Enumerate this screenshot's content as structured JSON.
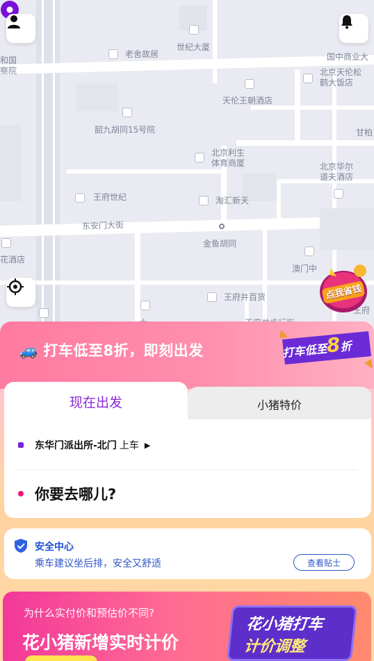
{
  "map": {
    "labels": {
      "he_guo": "和国",
      "cha_yuan": "察院",
      "lao_she": "老舍故居",
      "shiji_dasha": "世纪大厦",
      "guoji_shangye": "国中商业大",
      "tianlun_songhe_1": "北京天伦松",
      "tianlun_songhe_2": "鹤大饭店",
      "tianlun_wangchao": "天伦王朝酒店",
      "shaojiu": "韶九胡同15号院",
      "ganbai": "甘柏",
      "lisheng_1": "北京利生",
      "lisheng_2": "体育商厦",
      "huaer_1": "北京华尔",
      "huaer_2": "道夫酒店",
      "wangfu_shiji": "王府世纪",
      "danghui": "淘汇新天",
      "dongan": "东安门大街",
      "jinyu": "金鱼胡同",
      "hua_jiudian": "花酒店",
      "aomen": "澳门中",
      "wangfujing_baihuo": "王府井百货",
      "wangfu_right": "王府",
      "bottom_cut_1": "大",
      "bottom_cut_2": "王府井步行街"
    },
    "promo_badge": "点我省钱"
  },
  "header": {
    "user_icon": "user-icon",
    "bell_icon": "bell-icon",
    "locate_icon": "locate-icon"
  },
  "banner": {
    "emoji": "🚙",
    "title": "打车低至8折，即刻出发",
    "art_text": "打车低至",
    "art_big": "8",
    "art_suffix": "折"
  },
  "tabs": {
    "active": "现在出发",
    "inactive": "小猪特价"
  },
  "trip": {
    "pickup_name": "东华门派出所-北门",
    "pickup_suffix": "上车",
    "destination_placeholder": "你要去哪儿?"
  },
  "safety": {
    "title": "安全中心",
    "subtitle": "乘车建议坐后排，安全又舒适",
    "button": "查看贴士"
  },
  "bottom_promo": {
    "question": "为什么实付价和预估价不同?",
    "title": "花小猪新增实时计价",
    "art_line1": "花小猪打车",
    "art_line2": "计价调整"
  },
  "colors": {
    "accent_purple": "#8a28d8",
    "pin_purple": "#7a10d8",
    "banner_pink": "#ff7aa1",
    "safety_blue": "#2f57c7"
  }
}
